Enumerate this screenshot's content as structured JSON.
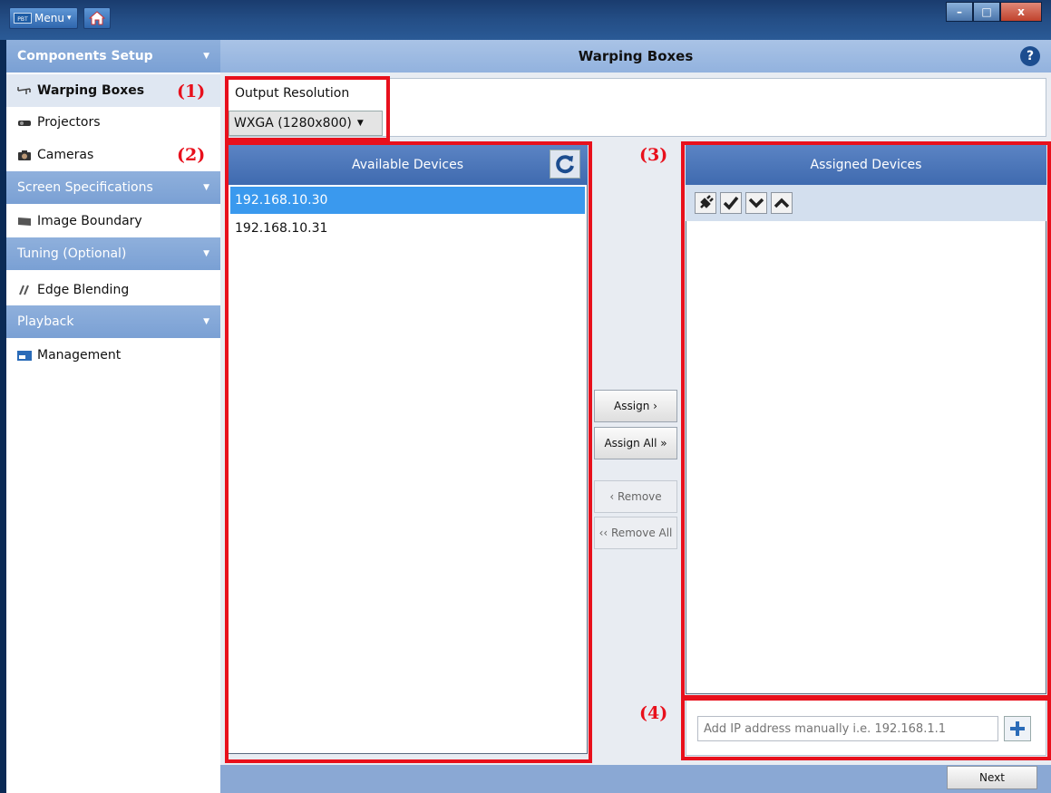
{
  "titlebar": {
    "menu_label": "Menu",
    "pbt_label": "PBT",
    "menu_caret": "▾",
    "minimize": "–",
    "maximize": "□",
    "close": "x"
  },
  "sidebar": {
    "sections": [
      {
        "label": "Components Setup",
        "caret": "▼"
      },
      {
        "label": "Screen Specifications",
        "caret": "▼"
      },
      {
        "label": "Tuning (Optional)",
        "caret": "▼"
      },
      {
        "label": "Playback",
        "caret": "▼"
      }
    ],
    "items": {
      "warping_boxes": "Warping Boxes",
      "projectors": "Projectors",
      "cameras": "Cameras",
      "image_boundary": "Image Boundary",
      "edge_blending": "Edge Blending",
      "management": "Management"
    }
  },
  "header": {
    "title": "Warping Boxes",
    "help": "?"
  },
  "resolution": {
    "label": "Output Resolution",
    "selected": "WXGA (1280x800)",
    "caret": "▼"
  },
  "available": {
    "title": "Available Devices",
    "devices": [
      "192.168.10.30",
      "192.168.10.31"
    ]
  },
  "actions": {
    "assign": "Assign ›",
    "assign_all": "Assign All »",
    "remove": "‹ Remove",
    "remove_all": "‹‹ Remove All"
  },
  "assigned": {
    "title": "Assigned Devices"
  },
  "ip": {
    "placeholder": "Add IP address manually i.e. 192.168.1.1",
    "add": "+"
  },
  "footer": {
    "next": "Next"
  },
  "annotations": [
    "(1)",
    "(2)",
    "(3)",
    "(4)"
  ],
  "colors": {
    "accent_red": "#e8101c",
    "header_blue": "#3f6aaf",
    "selection_blue": "#3a99ee"
  }
}
